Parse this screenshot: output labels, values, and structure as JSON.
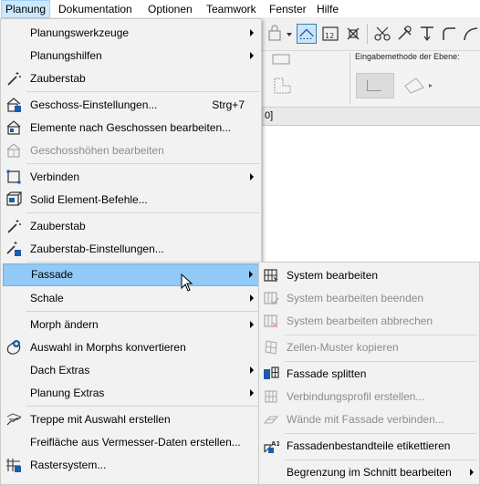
{
  "menubar": {
    "items": [
      "Planung",
      "Dokumentation",
      "Optionen",
      "Teamwork",
      "Fenster",
      "Hilfe"
    ]
  },
  "ribbon": {
    "label": "Eingabemethode der Ebene:",
    "tab_label": "0]"
  },
  "menu": {
    "items": [
      {
        "label": "Planungswerkzeuge",
        "icon": "none",
        "submenu": true
      },
      {
        "label": "Planungshilfen",
        "icon": "none",
        "submenu": true
      },
      {
        "label": "Zauberstab",
        "icon": "magic-wand-icon"
      },
      {
        "label": "Geschoss-Einstellungen...",
        "shortcut": "Strg+7",
        "icon": "story-settings-icon"
      },
      {
        "label": "Elemente nach Geschossen bearbeiten...",
        "icon": "edit-elements-by-story-icon"
      },
      {
        "label": "Geschosshöhen bearbeiten",
        "icon": "story-heights-icon",
        "disabled": true
      },
      {
        "label": "Verbinden",
        "icon": "connect-icon",
        "submenu": true
      },
      {
        "label": "Solid Element-Befehle...",
        "icon": "solid-element-icon"
      },
      {
        "label": "Zauberstab",
        "icon": "magic-wand-icon"
      },
      {
        "label": "Zauberstab-Einstellungen...",
        "icon": "magic-wand-settings-icon"
      },
      {
        "label": "Fassade",
        "icon": "none",
        "submenu": true,
        "highlighted": true
      },
      {
        "label": "Schale",
        "icon": "none",
        "submenu": true
      },
      {
        "label": "Morph ändern",
        "icon": "none",
        "submenu": true
      },
      {
        "label": "Auswahl in Morphs konvertieren",
        "icon": "convert-to-morph-icon"
      },
      {
        "label": "Dach Extras",
        "icon": "none",
        "submenu": true
      },
      {
        "label": "Planung Extras",
        "icon": "none",
        "submenu": true
      },
      {
        "label": "Treppe mit Auswahl erstellen",
        "icon": "stair-icon"
      },
      {
        "label": "Freifläche aus Vermesser-Daten erstellen...",
        "icon": "none"
      },
      {
        "label": "Rastersystem...",
        "icon": "grid-system-icon"
      }
    ]
  },
  "submenu": {
    "items": [
      {
        "label": "System bearbeiten",
        "icon": "curtain-wall-edit-icon"
      },
      {
        "label": "System bearbeiten beenden",
        "icon": "curtain-wall-edit-finish-icon",
        "disabled": true
      },
      {
        "label": "System bearbeiten abbrechen",
        "icon": "curtain-wall-edit-cancel-icon",
        "disabled": true
      },
      {
        "label": "Zellen-Muster kopieren",
        "icon": "copy-pattern-icon",
        "disabled": true
      },
      {
        "label": "Fassade splitten",
        "icon": "split-curtain-wall-icon"
      },
      {
        "label": "Verbindungsprofil erstellen...",
        "icon": "junction-profile-icon",
        "disabled": true
      },
      {
        "label": "Wände mit Fassade verbinden...",
        "icon": "connect-walls-icon",
        "disabled": true
      },
      {
        "label": "Fassadenbestandteile etikettieren",
        "icon": "label-members-icon"
      },
      {
        "label": "Begrenzung im Schnitt bearbeiten",
        "icon": "none",
        "submenu": true
      }
    ]
  },
  "colors": {
    "highlight": "#91c9f7",
    "menubar_active": "#cce8ff",
    "disabled_text": "#8c8c8c",
    "icon_blue": "#1e5ba8"
  }
}
